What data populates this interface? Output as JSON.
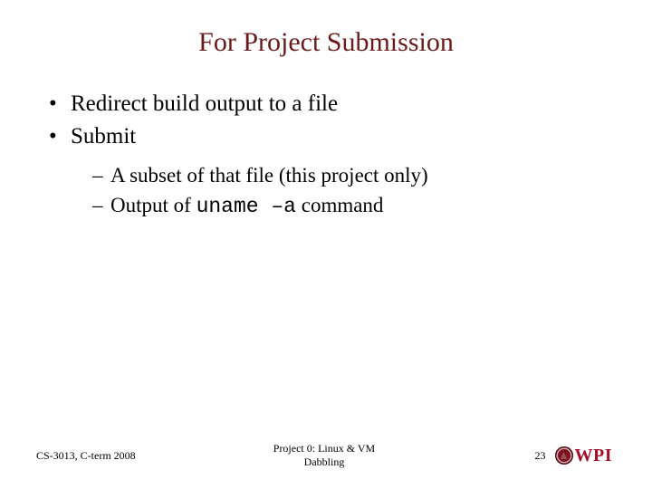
{
  "title": "For Project Submission",
  "bullets": {
    "items": [
      {
        "text": "Redirect build output to a file"
      },
      {
        "text": "Submit"
      }
    ],
    "sub": [
      {
        "before": "A subset of that file (this project only)"
      },
      {
        "before": "Output of ",
        "code": "uname –a",
        "after": " command"
      }
    ]
  },
  "footer": {
    "left": "CS-3013, C-term 2008",
    "center_line1": "Project 0: Linux & VM",
    "center_line2": "Dabbling",
    "page": "23",
    "logo_text": "WPI"
  }
}
